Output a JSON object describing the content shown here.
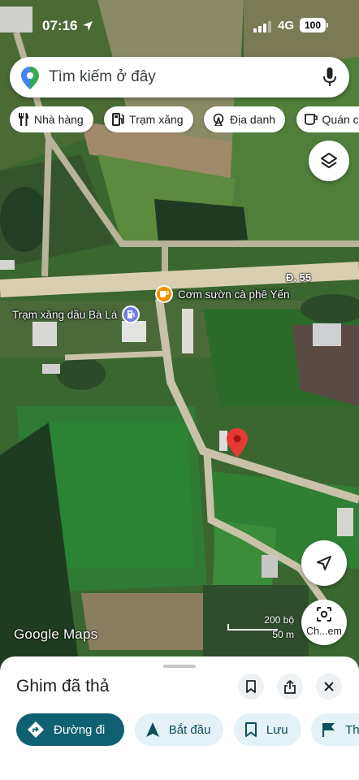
{
  "status_bar": {
    "time": "07:16",
    "network": "4G",
    "battery": "100"
  },
  "search": {
    "placeholder": "Tìm kiếm ở đây"
  },
  "chips": [
    "Nhà hàng",
    "Trạm xăng",
    "Địa danh",
    "Quán cà"
  ],
  "map": {
    "road_label": "Đ. 55",
    "poi_cafe": "Cơm sườn cà phê Yến",
    "poi_gas": "Trạm xăng dầu Bà Lá",
    "attribution": "Google Maps",
    "scale_ft": "200 bộ",
    "scale_m": "50 m",
    "lens_label": "Ch...em",
    "colors": {
      "pin": "#e53935",
      "cafe_badge": "#f29100",
      "gas_badge": "#6f7de6",
      "road": "#d9cfb0"
    }
  },
  "sheet": {
    "title": "Ghim đã thả",
    "actions": [
      "Đường đi",
      "Bắt đầu",
      "Lưu",
      "Thêm"
    ]
  }
}
